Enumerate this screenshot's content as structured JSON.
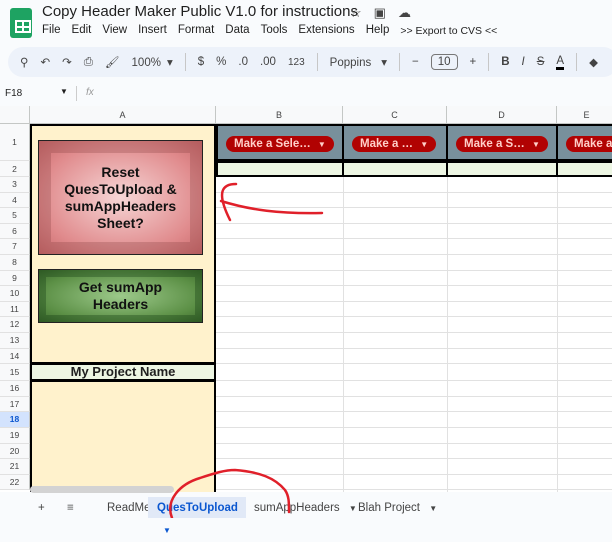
{
  "app": {
    "title": "Copy Header Maker Public V1.0 for instructions",
    "icons": [
      "star-icon",
      "move-folder-icon",
      "cloud-status-icon"
    ]
  },
  "menu": [
    "File",
    "Edit",
    "View",
    "Insert",
    "Format",
    "Data",
    "Tools",
    "Extensions",
    "Help",
    ">> Export to CVS <<"
  ],
  "toolbar": {
    "zoom": "100%",
    "currency": "$",
    "percent": "%",
    "dec_decrease": ".0",
    "dec_increase": ".00",
    "number_format": "123",
    "font": "Poppins",
    "font_size": "10",
    "minus": "−",
    "plus": "+",
    "bold": "B",
    "italic": "I",
    "strike": "S",
    "text_color": "A",
    "text_color_value": "#000000"
  },
  "formula_bar": {
    "cell_ref": "F18",
    "fx": "fx",
    "value": ""
  },
  "columns": [
    "A",
    "B",
    "C",
    "D",
    "E"
  ],
  "rows": [
    "1",
    "2",
    "3",
    "4",
    "5",
    "6",
    "7",
    "8",
    "9",
    "10",
    "11",
    "12",
    "13",
    "14",
    "15",
    "16",
    "17",
    "18",
    "19",
    "20",
    "21",
    "22"
  ],
  "selected_row": "18",
  "cells": {
    "dropdowns": [
      "Make a Sele…",
      "Make a …",
      "Make a S…",
      "Make a"
    ],
    "reset_button": "Reset QuesToUpload & sumAppHeaders Sheet?",
    "get_button": "Get sumApp Headers",
    "project_name": "My Project Name"
  },
  "colors": {
    "header_fill": "#78909c",
    "chip": "#b10202",
    "colA_fill": "#fff2cc",
    "row2_fill": "#edf6e3",
    "annotation": "#e0202a"
  },
  "tabs": {
    "add": "+",
    "list": "≡",
    "items": [
      {
        "label": "ReadMe"
      },
      {
        "label": "QuesToUpload",
        "active": true
      },
      {
        "label": "sumAppHeaders"
      },
      {
        "label": "Blah Project"
      }
    ]
  }
}
